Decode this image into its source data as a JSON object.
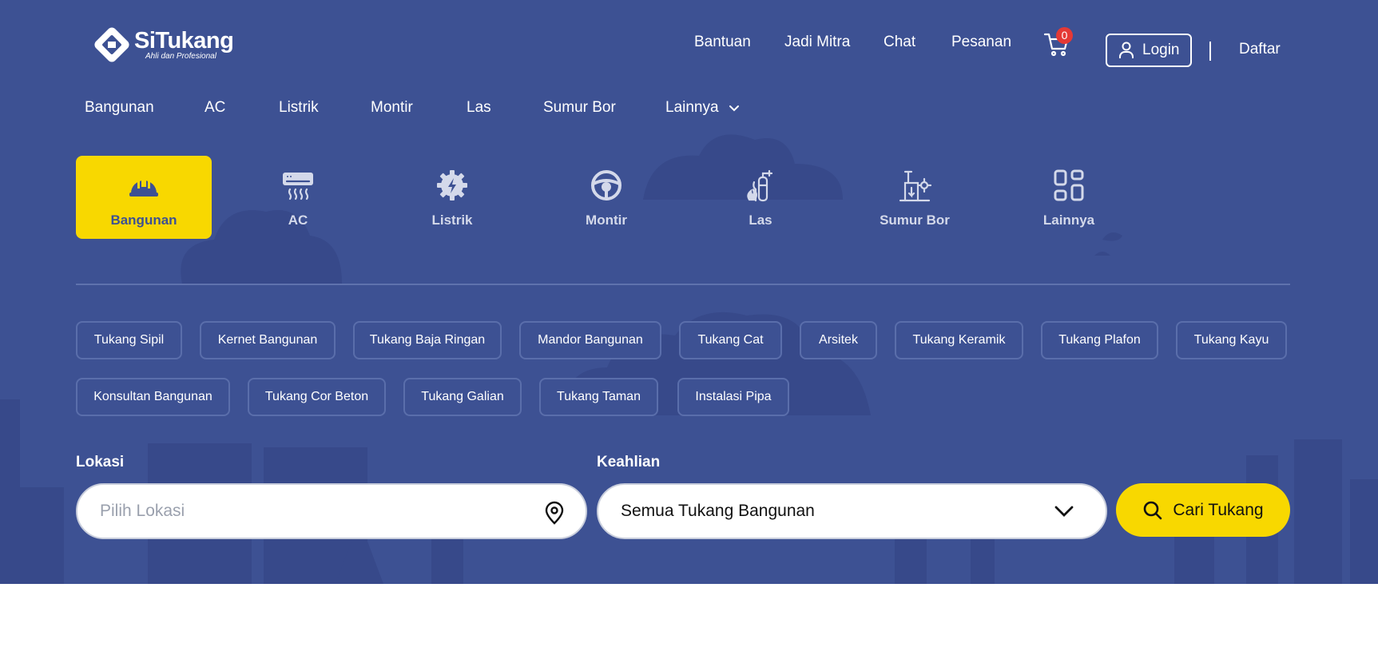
{
  "brand": {
    "name": "SiTukang",
    "tagline": "Ahli dan Profesional"
  },
  "header": {
    "nav": [
      {
        "label": "Bantuan"
      },
      {
        "label": "Jadi Mitra"
      },
      {
        "label": "Chat"
      },
      {
        "label": "Pesanan"
      }
    ],
    "cart_count": "0",
    "login_label": "Login",
    "register_label": "Daftar"
  },
  "category_nav": [
    {
      "label": "Bangunan"
    },
    {
      "label": "AC"
    },
    {
      "label": "Listrik"
    },
    {
      "label": "Montir"
    },
    {
      "label": "Las"
    },
    {
      "label": "Sumur Bor"
    },
    {
      "label": "Lainnya"
    }
  ],
  "category_tiles": [
    {
      "label": "Bangunan",
      "icon": "helmet-icon",
      "active": true
    },
    {
      "label": "AC",
      "icon": "ac-icon",
      "active": false
    },
    {
      "label": "Listrik",
      "icon": "electric-gear-icon",
      "active": false
    },
    {
      "label": "Montir",
      "icon": "steering-wheel-icon",
      "active": false
    },
    {
      "label": "Las",
      "icon": "welding-tank-icon",
      "active": false
    },
    {
      "label": "Sumur Bor",
      "icon": "drill-rig-icon",
      "active": false
    },
    {
      "label": "Lainnya",
      "icon": "grid-icon",
      "active": false
    }
  ],
  "subcategories": [
    "Tukang Sipil",
    "Kernet Bangunan",
    "Tukang Baja Ringan",
    "Mandor Bangunan",
    "Tukang Cat",
    "Arsitek",
    "Tukang Keramik",
    "Tukang Plafon",
    "Tukang Kayu",
    "Konsultan Bangunan",
    "Tukang Cor Beton",
    "Tukang Galian",
    "Tukang Taman",
    "Instalasi Pipa"
  ],
  "search": {
    "location_label": "Lokasi",
    "location_placeholder": "Pilih Lokasi",
    "skill_label": "Keahlian",
    "skill_value": "Semua Tukang Bangunan",
    "button_label": "Cari Tukang"
  },
  "colors": {
    "primary": "#3d5193",
    "accent": "#f8d800",
    "badge": "#e53935"
  }
}
